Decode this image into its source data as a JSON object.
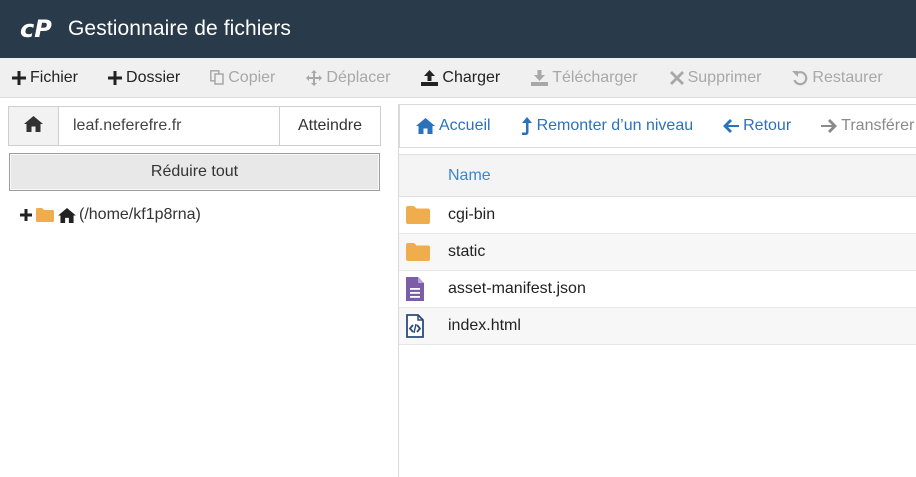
{
  "header": {
    "title": "Gestionnaire de fichiers"
  },
  "toolbar": {
    "items": [
      {
        "label": "Fichier",
        "icon": "plus-icon",
        "enabled": true
      },
      {
        "label": "Dossier",
        "icon": "plus-icon",
        "enabled": true
      },
      {
        "label": "Copier",
        "icon": "copy-icon",
        "enabled": false
      },
      {
        "label": "Déplacer",
        "icon": "move-icon",
        "enabled": false
      },
      {
        "label": "Charger",
        "icon": "upload-icon",
        "enabled": true
      },
      {
        "label": "Télécharger",
        "icon": "download-icon",
        "enabled": false
      },
      {
        "label": "Supprimer",
        "icon": "delete-icon",
        "enabled": false
      },
      {
        "label": "Restaurer",
        "icon": "restore-icon",
        "enabled": false
      }
    ]
  },
  "path_bar": {
    "value": "leaf.neferefre.fr",
    "go_label": "Atteindre"
  },
  "tree": {
    "collapse_label": "Réduire tout",
    "root_label": "(/home/kf1p8rna)"
  },
  "nav": {
    "home_label": "Accueil",
    "up_label": "Remonter d’un niveau",
    "back_label": "Retour",
    "transfer_label": "Transférer"
  },
  "table": {
    "header_name": "Name",
    "rows": [
      {
        "name": "cgi-bin",
        "type": "folder"
      },
      {
        "name": "static",
        "type": "folder"
      },
      {
        "name": "asset-manifest.json",
        "type": "text-file"
      },
      {
        "name": "index.html",
        "type": "code-file"
      }
    ]
  },
  "colors": {
    "header_bg": "#293a4a",
    "link_blue": "#2b72b9",
    "folder_orange": "#f0ad4e",
    "file_purple": "#7b5ea7",
    "code_blue": "#2c4a7c"
  }
}
